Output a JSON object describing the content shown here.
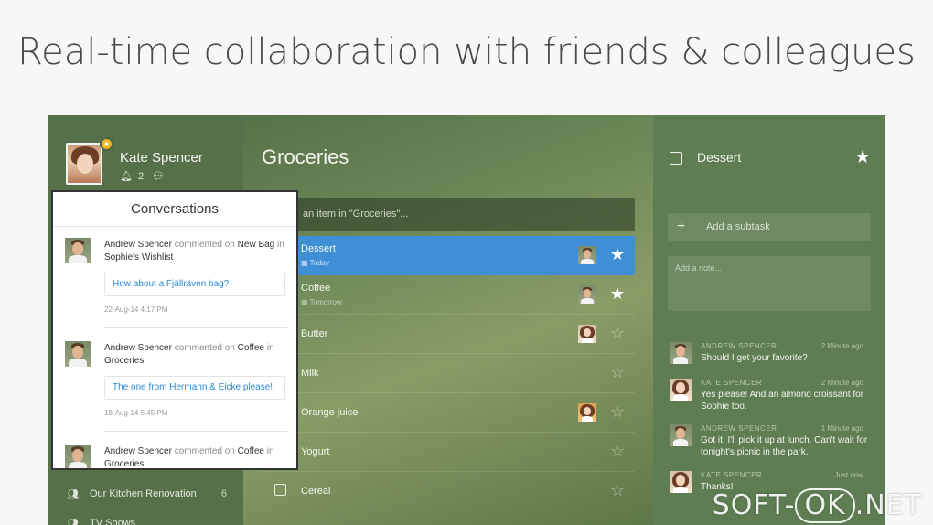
{
  "headline": "Real-time collaboration with friends & colleagues",
  "profile": {
    "name": "Kate Spencer",
    "notifications": "2"
  },
  "conversations": {
    "title": "Conversations",
    "entries": [
      {
        "author": "Andrew Spencer",
        "action": "commented on",
        "item": "New Bag",
        "prep": "in",
        "list": "Sophie's Wishlist",
        "quote": "How about a Fjällräven bag?",
        "when": "22-Aug-14 4:17 PM"
      },
      {
        "author": "Andrew Spencer",
        "action": "commented on",
        "item": "Coffee",
        "prep": "in",
        "list": "Groceries",
        "quote": "The one from Hermann & Eicke please!",
        "when": "18-Aug-14 5:45 PM"
      },
      {
        "author": "Andrew Spencer",
        "action": "commented on",
        "item": "Coffee",
        "prep": "in",
        "list": "Groceries"
      }
    ]
  },
  "sidebar": {
    "items": [
      {
        "label": "Our Kitchen Renovation",
        "count": "6"
      },
      {
        "label": "TV Shows",
        "count": ""
      }
    ]
  },
  "list": {
    "title": "Groceries",
    "add_placeholder": "an item in \"Groceries\"...",
    "tasks": [
      {
        "name": "Dessert",
        "due": "Today",
        "starred": true,
        "avatar": "male"
      },
      {
        "name": "Coffee",
        "due": "Tomorrow",
        "starred": true,
        "avatar": "male"
      },
      {
        "name": "Butter",
        "due": "",
        "starred": false,
        "avatar": "female"
      },
      {
        "name": "Milk",
        "due": "",
        "starred": false,
        "avatar": ""
      },
      {
        "name": "Orange juice",
        "due": "",
        "starred": false,
        "avatar": "female"
      },
      {
        "name": "Yogurt",
        "due": "",
        "starred": false,
        "avatar": ""
      },
      {
        "name": "Cereal",
        "due": "",
        "starred": false,
        "avatar": ""
      }
    ]
  },
  "detail": {
    "title": "Dessert",
    "subtask_placeholder": "Add a subtask",
    "note_placeholder": "Add a note...",
    "comments": [
      {
        "who": "ANDREW SPENCER",
        "time": "2 Minute ago",
        "msg": "Should I get your favorite?",
        "avatar": "male"
      },
      {
        "who": "KATE SPENCER",
        "time": "2 Minute ago",
        "msg": "Yes please! And an almond croissant for Sophie too.",
        "avatar": "female"
      },
      {
        "who": "ANDREW SPENCER",
        "time": "1 Minute ago",
        "msg": "Got it. I'll pick it up at lunch. Can't wait for tonight's picnic in the park.",
        "avatar": "male"
      },
      {
        "who": "KATE SPENCER",
        "time": "Just now",
        "msg": "Thanks!",
        "avatar": "female"
      }
    ]
  },
  "watermark": {
    "left": "SOFT-",
    "mid": "OK",
    "right": ".NET"
  },
  "colors": {
    "accent": "#3f8fd7",
    "sidebar": "#56704a",
    "detail": "#5e7d52"
  }
}
